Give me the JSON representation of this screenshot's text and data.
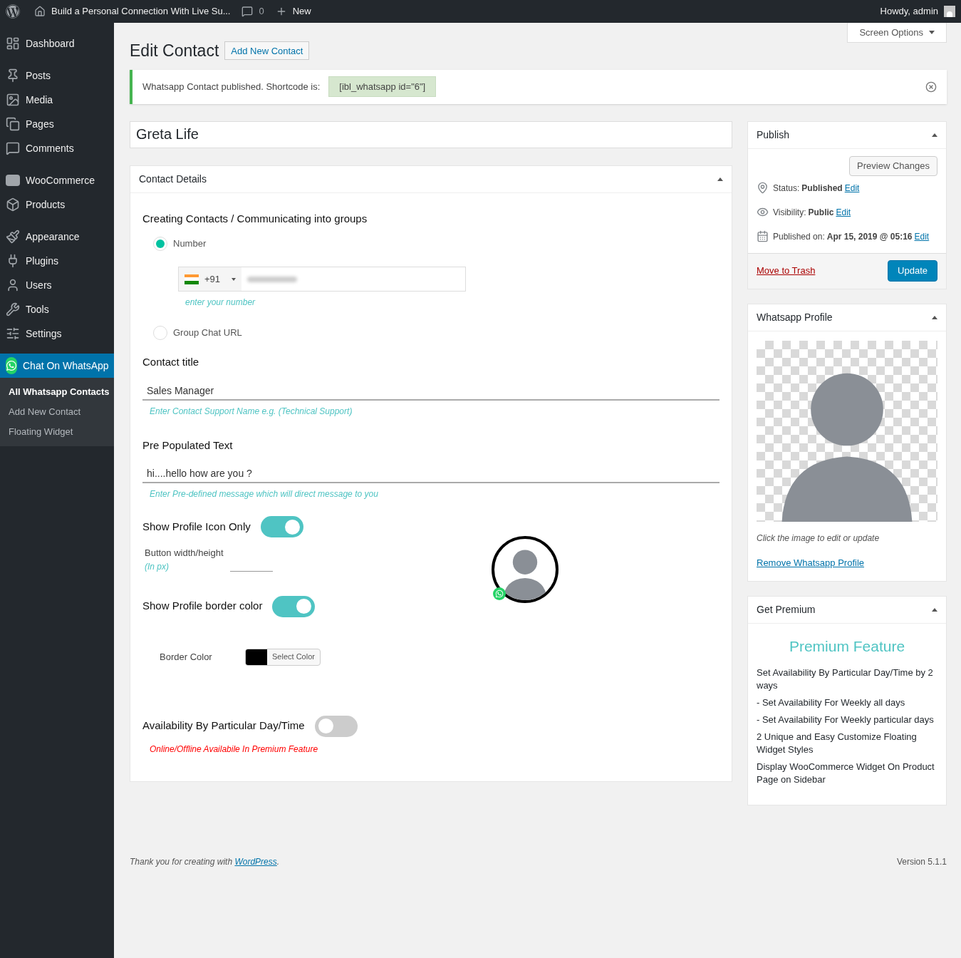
{
  "admin_bar": {
    "site_title": "Build a Personal Connection With Live Su...",
    "comments_count": "0",
    "new_label": "New",
    "greeting": "Howdy, admin"
  },
  "sidebar": {
    "items": [
      {
        "label": "Dashboard",
        "selected": false
      },
      {
        "label": "Posts",
        "selected": false
      },
      {
        "label": "Media",
        "selected": false
      },
      {
        "label": "Pages",
        "selected": false
      },
      {
        "label": "Comments",
        "selected": false
      },
      {
        "label": "WooCommerce",
        "selected": false
      },
      {
        "label": "Products",
        "selected": false
      },
      {
        "label": "Appearance",
        "selected": false
      },
      {
        "label": "Plugins",
        "selected": false
      },
      {
        "label": "Users",
        "selected": false
      },
      {
        "label": "Tools",
        "selected": false
      },
      {
        "label": "Settings",
        "selected": false
      },
      {
        "label": "Chat On WhatsApp",
        "selected": true
      }
    ],
    "submenu": [
      {
        "label": "All Whatsapp Contacts",
        "selected": true
      },
      {
        "label": "Add New Contact",
        "selected": false
      },
      {
        "label": "Floating Widget",
        "selected": false
      }
    ]
  },
  "screen_options": "Screen Options",
  "heading": "Edit Contact",
  "add_new_button": "Add New Contact",
  "notice": {
    "text": "Whatsapp Contact published. Shortcode is:",
    "shortcode": "[ibl_whatsapp id=\"6\"]"
  },
  "title_field": "Greta Life",
  "contact_details": {
    "title": "Contact Details",
    "section_title": "Creating Contacts / Communicating into groups",
    "options": [
      {
        "label": "Number",
        "selected": true
      },
      {
        "label": "Group Chat URL",
        "selected": false
      }
    ],
    "country_code": "+91",
    "number_hint": "enter your number",
    "contact_title_label": "Contact title",
    "contact_title_value": "Sales Manager",
    "contact_title_hint": "Enter Contact Support Name e.g. (Technical Support)",
    "prepopulated_label": "Pre Populated Text",
    "prepopulated_value": "hi....hello how are you ?",
    "prepopulated_hint": "Enter Pre-defined message which will direct message to you",
    "show_icon_only": {
      "label": "Show Profile Icon Only",
      "on": true
    },
    "button_size_label": "Button width/height",
    "button_size_unit": "(In px)",
    "show_border": {
      "label": "Show Profile border color",
      "on": true
    },
    "border_color_label": "Border Color",
    "select_color_button": "Select Color",
    "availability": {
      "label": "Availability By Particular Day/Time",
      "on": false
    },
    "availability_note": "Online/Offline Availabile In Premium Feature"
  },
  "publish": {
    "title": "Publish",
    "preview_button": "Preview Changes",
    "rows": [
      {
        "label": "Status:",
        "value": "Published",
        "link": "Edit"
      },
      {
        "label": "Visibility:",
        "value": "Public",
        "link": "Edit"
      },
      {
        "label": "Published on:",
        "value": "Apr 15, 2019 @ 05:16",
        "link": "Edit"
      }
    ],
    "trash_link": "Move to Trash",
    "update_button": "Update"
  },
  "profile": {
    "title": "Whatsapp Profile",
    "hint": "Click the image to edit or update",
    "remove_link": "Remove Whatsapp Profile"
  },
  "premium": {
    "title": "Get Premium",
    "heading": "Premium Feature",
    "lines": [
      "Set Availability By Particular Day/Time by 2 ways",
      "- Set Availability For Weekly all days",
      "- Set Availability For Weekly particular days",
      "2 Unique and Easy Customize Floating Widget Styles",
      "Display WooCommerce Widget On Product Page on Sidebar"
    ]
  },
  "footer": {
    "text_before": "Thank you for creating with",
    "link": "WordPress",
    "text_after": ".",
    "version": "Version 5.1.1"
  }
}
